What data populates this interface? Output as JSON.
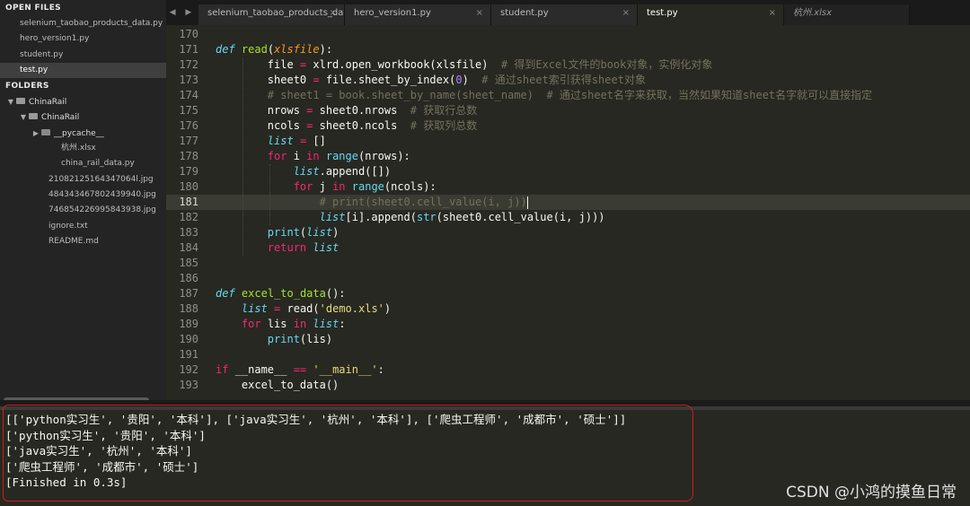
{
  "sidebar": {
    "open_files_title": "OPEN FILES",
    "open_files": [
      {
        "label": "selenium_taobao_products_data.py"
      },
      {
        "label": "hero_version1.py"
      },
      {
        "label": "student.py"
      },
      {
        "label": "test.py"
      }
    ],
    "folders_title": "FOLDERS",
    "tree": [
      {
        "label": "ChinaRail"
      },
      {
        "label": "ChinaRail"
      },
      {
        "label": "__pycache__"
      },
      {
        "label": "杭州.xlsx"
      },
      {
        "label": "china_rail_data.py"
      },
      {
        "label": "21082125164347064l.jpg"
      },
      {
        "label": "484343467802439940.jpg"
      },
      {
        "label": "746854226995843938.jpg"
      },
      {
        "label": "ignore.txt"
      },
      {
        "label": "README.md"
      }
    ]
  },
  "tabs": [
    {
      "label": "selenium_taobao_products_data.py",
      "close": "×"
    },
    {
      "label": "hero_version1.py",
      "close": "×"
    },
    {
      "label": "student.py",
      "close": "×"
    },
    {
      "label": "test.py",
      "close": "×"
    },
    {
      "label": "杭州.xlsx",
      "close": ""
    }
  ],
  "tabnav": "◀ ▶",
  "editor": {
    "line_numbers": [
      "170",
      "171",
      "172",
      "173",
      "174",
      "175",
      "176",
      "177",
      "178",
      "179",
      "180",
      "181",
      "182",
      "183",
      "184",
      "185",
      "186",
      "187",
      "188",
      "189",
      "190",
      "191",
      "192",
      "193"
    ],
    "lines": [
      "",
      "def read(xlsfile):",
      "        file = xlrd.open_workbook(xlsfile)  # 得到Excel文件的book对象，实例化对象",
      "        sheet0 = file.sheet_by_index(0)  # 通过sheet索引获得sheet对象",
      "        # sheet1 = book.sheet_by_name(sheet_name)  # 通过sheet名字来获取，当然如果知道sheet名字就可以直接指定",
      "        nrows = sheet0.nrows  # 获取行总数",
      "        ncols = sheet0.ncols  # 获取列总数",
      "        list = []",
      "        for i in range(nrows):",
      "            list.append([])",
      "            for j in range(ncols):",
      "                # print(sheet0.cell_value(i, j))",
      "                list[i].append(str(sheet0.cell_value(i, j)))",
      "        print(list)",
      "        return list",
      "",
      "",
      "def excel_to_data():",
      "    list = read('demo.xls')",
      "    for lis in list:",
      "        print(lis)",
      "",
      "if __name__ == '__main__':",
      "    excel_to_data()"
    ]
  },
  "output": {
    "lines": [
      "[['python实习生', '贵阳', '本科'], ['java实习生', '杭州', '本科'], ['爬虫工程师', '成都市', '硕士']]",
      "['python实习生', '贵阳', '本科']",
      "['java实习生', '杭州', '本科']",
      "['爬虫工程师', '成都市', '硕士']",
      "[Finished in 0.3s]"
    ]
  },
  "watermark": "CSDN @小鸿的摸鱼日常",
  "colors": {
    "background": "#272822",
    "keyword": "#66d9ef",
    "operator": "#f92672",
    "string": "#e6db74",
    "number": "#ae81ff",
    "comment": "#75715e",
    "highlight_box": "#d21b1b"
  }
}
